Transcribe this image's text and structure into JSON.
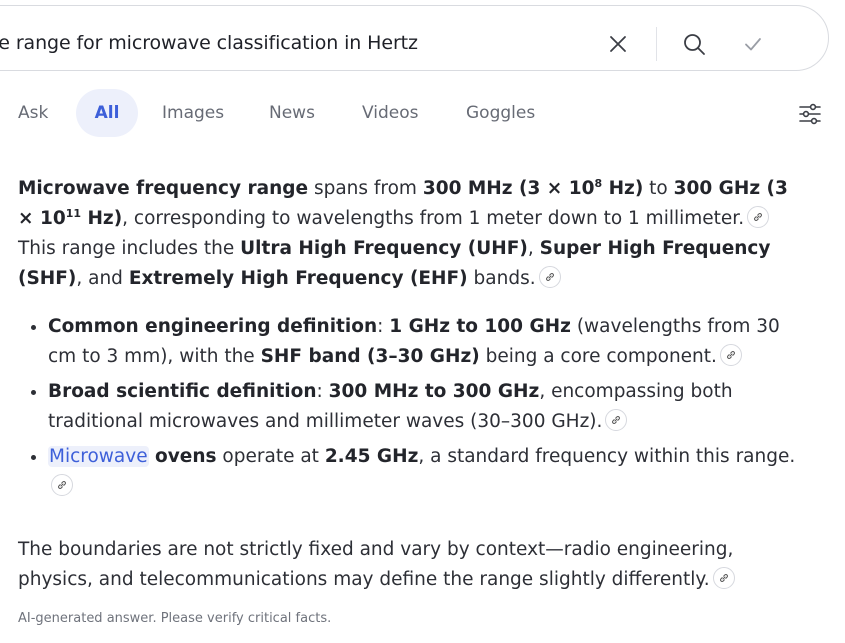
{
  "search": {
    "query": "the range for microwave classification in Hertz",
    "icons": {
      "clear": "close-icon",
      "search": "search-icon",
      "submit": "checkmark-icon"
    }
  },
  "tabs": [
    {
      "label": "Ask"
    },
    {
      "label": "All",
      "active": true
    },
    {
      "label": "Images"
    },
    {
      "label": "News"
    },
    {
      "label": "Videos"
    },
    {
      "label": "Goggles"
    }
  ],
  "answer": {
    "p1": {
      "t1": "Microwave frequency range",
      "t2": " spans from ",
      "t3": "300 MHz (3 × 10",
      "t3sup": "8",
      "t4": " Hz)",
      "t5": " to ",
      "t6": "300 GHz (3 × 10",
      "t6sup": "11",
      "t7": " Hz)",
      "t8": ", corresponding to wavelengths from 1 meter down to 1 millimeter.",
      "t9": " This range includes the ",
      "t10": "Ultra High Frequency (UHF)",
      "t11": ", ",
      "t12": "Super High Frequency (SHF)",
      "t13": ", and ",
      "t14": "Extremely High Frequency (EHF)",
      "t15": " bands."
    },
    "bullets": [
      {
        "b1": "Common engineering definition",
        "b2": ": ",
        "b3": "1 GHz to 100 GHz",
        "b4": " (wavelengths from 30 cm to 3 mm), with the ",
        "b5": "SHF band (3–30 GHz)",
        "b6": " being a core component."
      },
      {
        "b1": "Broad scientific definition",
        "b2": ": ",
        "b3": "300 MHz to 300 GHz",
        "b4": ", encompassing both traditional microwaves and millimeter waves (30–300 GHz)."
      },
      {
        "link": "Microwave",
        "b1": " ovens",
        "b2": " operate at ",
        "b3": "2.45 GHz",
        "b4": ", a standard frequency within this range."
      }
    ],
    "p2": "The boundaries are not strictly fixed and vary by context—radio engineering, physics, and telecommunications may define the range slightly differently.",
    "citation_icon": "link-icon"
  },
  "disclaimer": "AI-generated answer. Please verify critical facts.",
  "colors": {
    "accent": "#3d5fd9",
    "accent_bg": "#edf0fb",
    "text": "#2d2f36",
    "muted": "#676b75"
  }
}
